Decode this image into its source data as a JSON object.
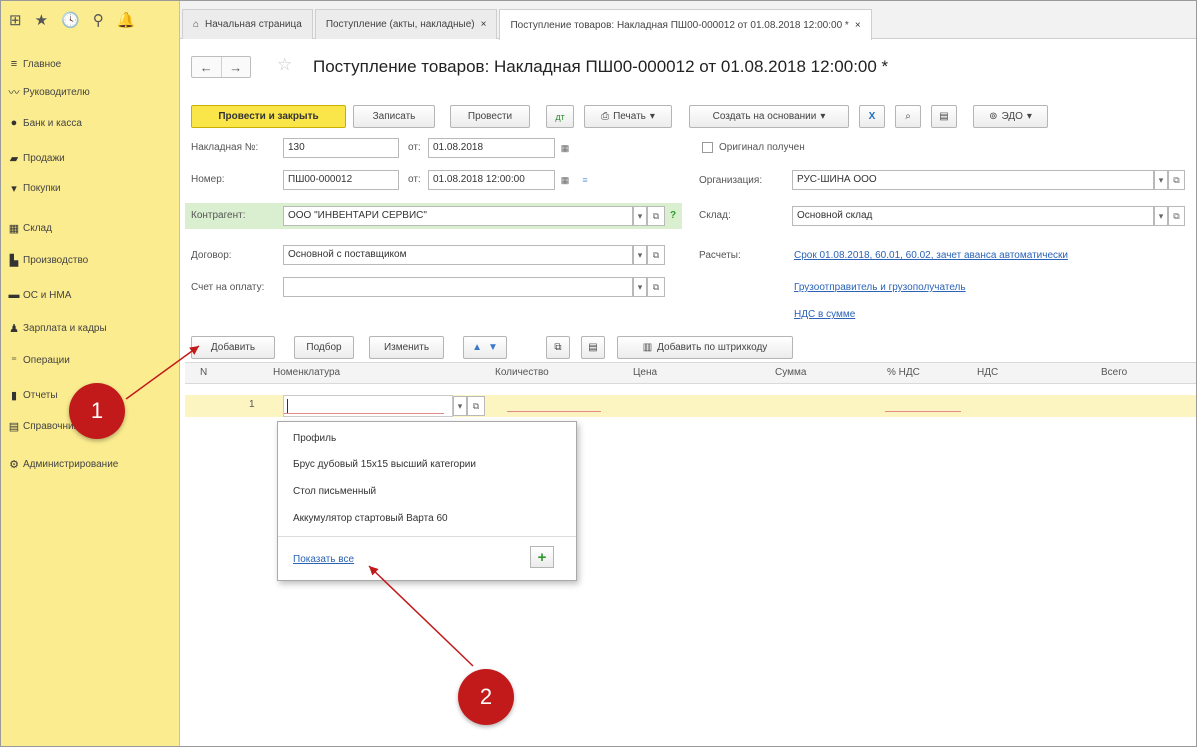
{
  "tabs": [
    {
      "label": "Начальная страница",
      "icon": "home-icon"
    },
    {
      "label": "Поступление (акты, накладные)",
      "close": "×"
    },
    {
      "label": "Поступление товаров: Накладная ПШ00-000012 от 01.08.2018 12:00:00 *",
      "close": "×"
    }
  ],
  "sidebar": {
    "items": [
      {
        "label": "Главное",
        "icon": "menu-icon"
      },
      {
        "label": "Руководителю",
        "icon": "chart-line-icon"
      },
      {
        "label": "Банк и касса",
        "icon": "bank-icon"
      },
      {
        "label": "Продажи",
        "icon": "bag-icon"
      },
      {
        "label": "Покупки",
        "icon": "cart-icon"
      },
      {
        "label": "Склад",
        "icon": "warehouse-icon"
      },
      {
        "label": "Производство",
        "icon": "factory-icon"
      },
      {
        "label": "ОС и НМА",
        "icon": "truck-icon"
      },
      {
        "label": "Зарплата и кадры",
        "icon": "person-icon"
      },
      {
        "label": "Операции",
        "icon": "operations-icon"
      },
      {
        "label": "Отчеты",
        "icon": "bar-chart-icon"
      },
      {
        "label": "Справочники",
        "icon": "book-icon"
      },
      {
        "label": "Администрирование",
        "icon": "gear-icon"
      }
    ]
  },
  "document": {
    "title": "Поступление товаров: Накладная ПШ00-000012 от 01.08.2018 12:00:00 *"
  },
  "toolbar": {
    "post_close": "Провести и закрыть",
    "save": "Записать",
    "post": "Провести",
    "print": "Печать",
    "create_based": "Создать на основании",
    "edo": "ЭДО"
  },
  "form": {
    "invoice_no_label": "Накладная №:",
    "invoice_no": "130",
    "from_label": "от:",
    "invoice_date": "01.08.2018",
    "number_label": "Номер:",
    "number": "ПШ00-000012",
    "from_label2": "от:",
    "number_datetime": "01.08.2018 12:00:00",
    "original_received": "Оригинал получен",
    "org_label": "Организация:",
    "org": "РУС-ШИНА ООО",
    "contractor_label": "Контрагент:",
    "contractor": "ООО \"ИНВЕНТАРИ СЕРВИС\"",
    "help": "?",
    "warehouse_label": "Склад:",
    "warehouse": "Основной склад",
    "contract_label": "Договор:",
    "contract": "Основной с поставщиком",
    "settlements_label": "Расчеты:",
    "settlements_link": "Срок 01.08.2018, 60.01, 60.02, зачет аванса автоматически",
    "payment_label": "Счет на оплату:",
    "payment": "",
    "shipper_link": "Грузоотправитель и грузополучатель",
    "vat_link": "НДС в сумме"
  },
  "table_toolbar": {
    "add": "Добавить",
    "pick": "Подбор",
    "change": "Изменить",
    "add_barcode": "Добавить по штрихкоду"
  },
  "table": {
    "columns": [
      "N",
      "Номенклатура",
      "Количество",
      "Цена",
      "Сумма",
      "% НДС",
      "НДС",
      "Всего"
    ],
    "rows": [
      {
        "n": "1",
        "nomenclature": "",
        "quantity": "",
        "price": "",
        "sum": "",
        "vat_rate": "",
        "vat": "",
        "total": ""
      }
    ]
  },
  "dropdown": {
    "items": [
      "Профиль",
      "Брус дубовый 15х15 высший категории",
      "Стол письменный",
      "Аккумулятор стартовый Варта 60"
    ],
    "show_all": "Показать все",
    "add": "+"
  },
  "markers": [
    "1",
    "2"
  ],
  "colors": {
    "sidebar_bg": "#fbec8f",
    "primary_button": "#fbe64a",
    "link": "#2b63b8",
    "marker": "#c21a1a",
    "selected_row": "#fdf5c1",
    "contractor_band": "#d9efd0"
  }
}
